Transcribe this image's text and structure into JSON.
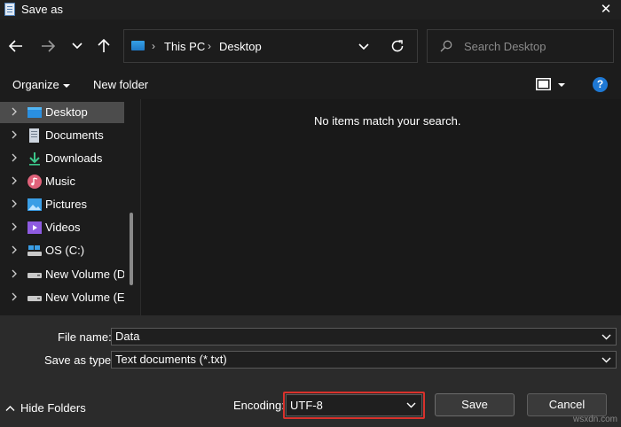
{
  "window": {
    "title": "Save as",
    "close_glyph": "✕"
  },
  "nav": {
    "path": [
      "This PC",
      "Desktop"
    ],
    "search_placeholder": "Search Desktop"
  },
  "toolbar": {
    "organize_label": "Organize",
    "new_folder_label": "New folder",
    "help_label": "?"
  },
  "sidebar": {
    "items": [
      {
        "label": "Desktop",
        "icon": "desktop-icon",
        "selected": true
      },
      {
        "label": "Documents",
        "icon": "documents-icon"
      },
      {
        "label": "Downloads",
        "icon": "download-icon"
      },
      {
        "label": "Music",
        "icon": "music-icon"
      },
      {
        "label": "Pictures",
        "icon": "pictures-icon"
      },
      {
        "label": "Videos",
        "icon": "videos-icon"
      },
      {
        "label": "OS (C:)",
        "icon": "os-drive-icon"
      },
      {
        "label": "New Volume (D:",
        "icon": "drive-icon"
      },
      {
        "label": "New Volume (E:)",
        "icon": "drive-icon"
      }
    ]
  },
  "main": {
    "empty_message": "No items match your search."
  },
  "form": {
    "file_name_label": "File name:",
    "file_name_value": "Data",
    "save_as_type_label": "Save as type:",
    "save_as_type_value": "Text documents (*.txt)",
    "encoding_label": "Encoding:",
    "encoding_value": "UTF-8",
    "save_label": "Save",
    "cancel_label": "Cancel",
    "hide_folders_label": "Hide Folders"
  },
  "watermark": "wsxdn.com",
  "colors": {
    "accent": "#1e78d4",
    "highlight": "#d9322c",
    "selected_row": "#4c4c4c"
  }
}
